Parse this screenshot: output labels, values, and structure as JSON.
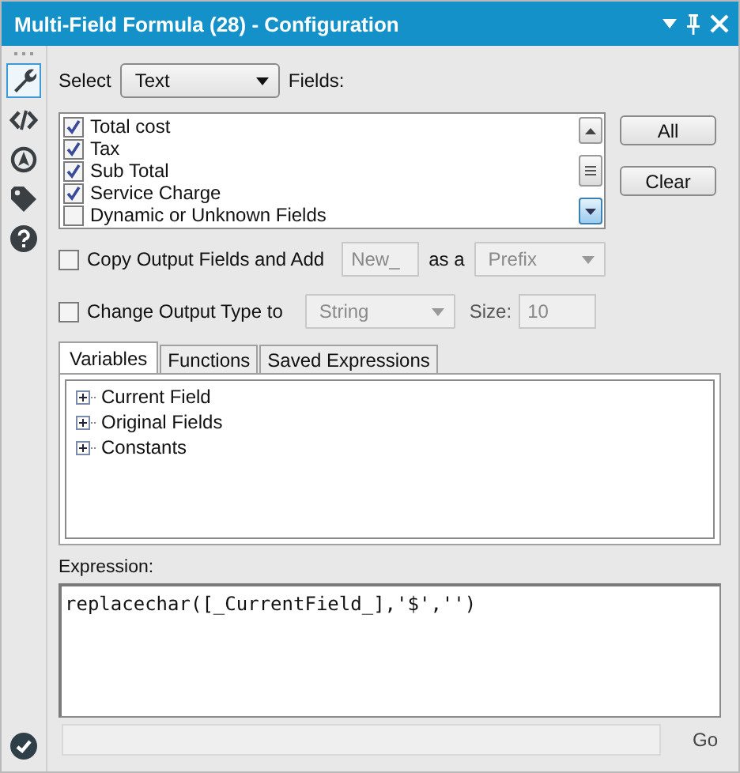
{
  "window": {
    "title": "Multi-Field Formula (28) - Configuration"
  },
  "sidebar": {
    "items": [
      {
        "kind": "wrench",
        "selected": true
      },
      {
        "kind": "code",
        "selected": false
      },
      {
        "kind": "target",
        "selected": false
      },
      {
        "kind": "tag",
        "selected": false
      },
      {
        "kind": "help",
        "selected": false
      }
    ]
  },
  "select": {
    "label": "Select",
    "value": "Text",
    "fields_label": "Fields:"
  },
  "fields": [
    {
      "label": "Total cost",
      "checked": true
    },
    {
      "label": "Tax",
      "checked": true
    },
    {
      "label": "Sub Total",
      "checked": true
    },
    {
      "label": "Service Charge",
      "checked": true
    },
    {
      "label": "Dynamic or Unknown Fields",
      "checked": false
    }
  ],
  "buttons": [
    "All",
    "Clear"
  ],
  "copy_output": {
    "label": "Copy Output Fields and Add",
    "checked": false,
    "value": "New_",
    "as_label": "as a",
    "position": "Prefix"
  },
  "change_type": {
    "label": "Change Output Type to",
    "checked": false,
    "type": "String",
    "size_label": "Size:",
    "size": "10"
  },
  "tabs": [
    {
      "label": "Variables",
      "selected": true
    },
    {
      "label": "Functions",
      "selected": false
    },
    {
      "label": "Saved Expressions",
      "selected": false
    }
  ],
  "tree": [
    {
      "label": "Current Field",
      "expanded": false
    },
    {
      "label": "Original Fields",
      "expanded": false
    },
    {
      "label": "Constants",
      "expanded": false
    }
  ],
  "expression": {
    "label": "Expression:",
    "value": "replacechar([_CurrentField_],'$','')"
  },
  "run": {
    "label": "Go"
  }
}
